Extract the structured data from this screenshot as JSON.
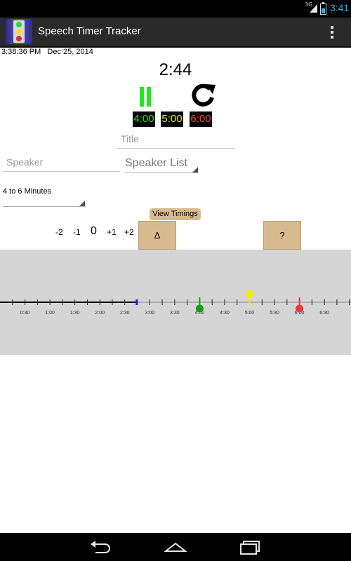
{
  "status_bar": {
    "network": "3G",
    "time": "3:41"
  },
  "action_bar": {
    "title": "Speech Timer Tracker",
    "app_icon": "traffic-light-icon",
    "menu_icon": "overflow-menu-icon"
  },
  "timer": {
    "datetime": "3:38:36 PM   Dec 25, 2014",
    "elapsed": "2:44",
    "pause_icon": "pause-icon",
    "reset_icon": "reset-icon",
    "green_time": "4:00",
    "yellow_time": "5:00",
    "red_time": "6:00"
  },
  "fields": {
    "title_placeholder": "Title",
    "speaker_placeholder": "Speaker",
    "speaker_list_label": "Speaker List",
    "duration_selected": "4 to 6 Minutes"
  },
  "adjust": {
    "minus2": "-2",
    "minus1": "-1",
    "zero": "0",
    "plus1": "+1",
    "plus2": "+2",
    "view_timings_label": "View Timings",
    "delta_label": "Δ",
    "help_label": "?"
  },
  "timeline": {
    "tick_labels": [
      "0:30",
      "1:00",
      "1:30",
      "2:00",
      "2:30",
      "3:00",
      "3:30",
      "4:00",
      "4:30",
      "5:00",
      "5:30",
      "6:00",
      "6:30"
    ],
    "elapsed_seconds": 164,
    "markers": [
      {
        "name": "green",
        "seconds": 240,
        "color": "#11a011"
      },
      {
        "name": "yellow",
        "seconds": 300,
        "color": "#f0f000"
      },
      {
        "name": "red",
        "seconds": 360,
        "color": "#e83a3a"
      }
    ]
  },
  "colors": {
    "green": "#23e623",
    "yellow": "#f0f000",
    "red": "#ff4040",
    "tan_button": "#d8ba8f",
    "panel": "#d5d5d5",
    "clock_blue": "#33b5e5"
  },
  "nav_bar": {
    "back_icon": "back-icon",
    "home_icon": "home-icon",
    "recents_icon": "recents-icon"
  }
}
